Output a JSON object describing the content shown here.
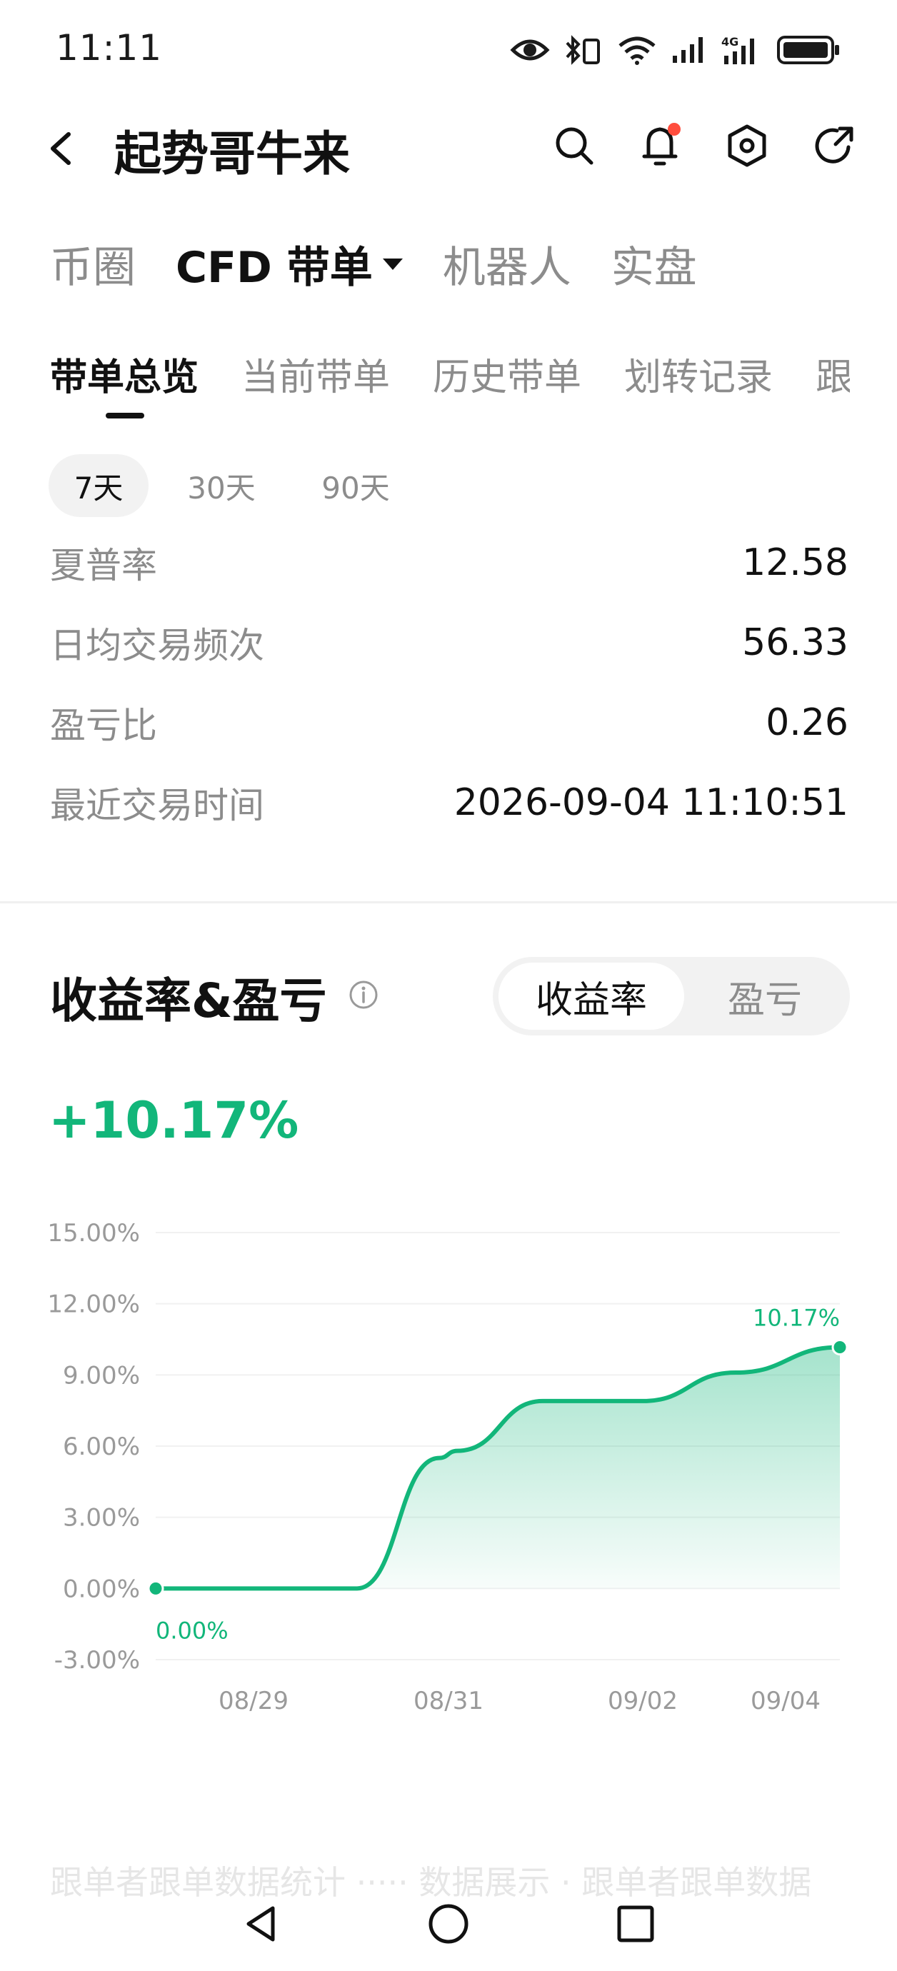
{
  "status_bar": {
    "time": "11:11",
    "icons": [
      "eye-icon",
      "bluetooth-icon",
      "wifi-icon",
      "signal-icon",
      "signal-4g-icon",
      "battery-icon"
    ]
  },
  "header": {
    "title": "起势哥牛来",
    "icons": [
      "back-icon",
      "search-icon",
      "bell-icon",
      "settings-icon",
      "share-icon"
    ],
    "notification_dot_color": "#ff4d3d"
  },
  "top_tabs": [
    {
      "label": "币圈",
      "active": false
    },
    {
      "label": "CFD 带单",
      "active": true
    },
    {
      "label": "机器人",
      "active": false
    },
    {
      "label": "实盘",
      "active": false
    }
  ],
  "sub_tabs": [
    {
      "label": "带单总览",
      "active": true
    },
    {
      "label": "当前带单",
      "active": false
    },
    {
      "label": "历史带单",
      "active": false
    },
    {
      "label": "划转记录",
      "active": false
    },
    {
      "label": "跟",
      "active": false
    }
  ],
  "ranges": [
    {
      "label": "7天",
      "active": true
    },
    {
      "label": "30天",
      "active": false
    },
    {
      "label": "90天",
      "active": false
    }
  ],
  "stats": [
    {
      "label": "夏普率",
      "value": "12.58"
    },
    {
      "label": "日均交易频次",
      "value": "56.33"
    },
    {
      "label": "盈亏比",
      "value": "0.26"
    },
    {
      "label": "最近交易时间",
      "value": "2026-09-04 11:10:51"
    }
  ],
  "section": {
    "title": "收益率&盈亏",
    "toggle": [
      "收益率",
      "盈亏"
    ],
    "active_toggle": "收益率",
    "headline_value": "+10.17%"
  },
  "colors": {
    "accent": "#12b67a",
    "muted": "#8c8c8c",
    "text": "#111111"
  },
  "chart_data": {
    "type": "area",
    "title": "",
    "xlabel": "",
    "ylabel": "",
    "ylim": [
      -3,
      15
    ],
    "y_ticks": [
      "15.00%",
      "12.00%",
      "9.00%",
      "6.00%",
      "3.00%",
      "0.00%",
      "-3.00%"
    ],
    "x_ticks": [
      "08/29",
      "08/31",
      "09/02",
      "09/04"
    ],
    "x": [
      "08/28",
      "08/29",
      "08/30",
      "08/30",
      "08/31",
      "08/31",
      "09/01",
      "09/02",
      "09/03",
      "09/04"
    ],
    "series": [
      {
        "values": [
          0.0,
          0.0,
          0.0,
          0.0,
          5.5,
          5.8,
          7.9,
          7.9,
          9.1,
          10.17
        ]
      }
    ],
    "point_labels": {
      "start": "0.00%",
      "end": "10.17%"
    },
    "grid": true
  },
  "faded_text": "跟单者跟单数据统计 ····· 数据展示 · 跟单者跟单数据",
  "nav_bar": [
    "back-nav-icon",
    "home-nav-icon",
    "recents-nav-icon"
  ]
}
